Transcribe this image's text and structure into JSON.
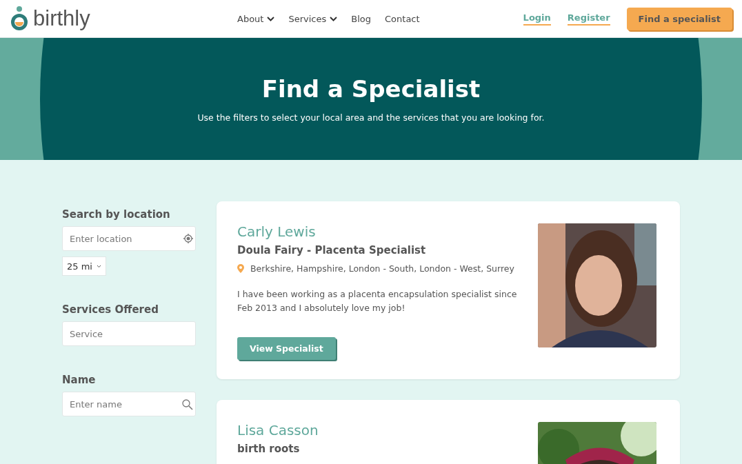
{
  "header": {
    "logo": "birthly",
    "nav": [
      {
        "label": "About",
        "dropdown": true
      },
      {
        "label": "Services",
        "dropdown": true
      },
      {
        "label": "Blog",
        "dropdown": false
      },
      {
        "label": "Contact",
        "dropdown": false
      }
    ],
    "links": [
      "Login",
      "Register"
    ],
    "cta": "Find a specialist"
  },
  "hero": {
    "title": "Find a Specialist",
    "subtitle": "Use the filters to select your local area and the services that you are looking for."
  },
  "filters": {
    "location": {
      "label": "Search by location",
      "placeholder": "Enter location"
    },
    "radius": "25 mi",
    "services": {
      "label": "Services Offered",
      "placeholder": "Service"
    },
    "name": {
      "label": "Name",
      "placeholder": "Enter name"
    }
  },
  "specialists": [
    {
      "name": "Carly Lewis",
      "business": "Doula Fairy - Placenta Specialist",
      "areas": "Berkshire, Hampshire, London - South, London - West, Surrey",
      "bio": "I have been working as a placenta encapsulation specialist since Feb 2013 and I absolutely love my job!",
      "button": "View Specialist"
    },
    {
      "name": "Lisa Casson",
      "business": "birth roots"
    }
  ]
}
